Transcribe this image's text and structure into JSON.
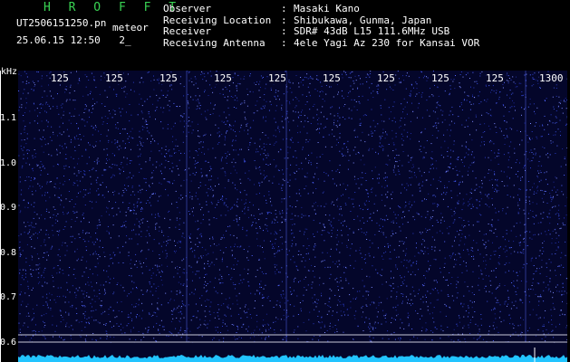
{
  "header": {
    "brand": "H R O F F T",
    "filename": "UT2506151250.pn",
    "tag": "meteor",
    "timestamp": "25.06.15 12:50",
    "counter": "2_",
    "fields": [
      {
        "key": "Observer",
        "value": "Masaki Kano"
      },
      {
        "key": "Receiving Location",
        "value": "Shibukawa, Gunma, Japan"
      },
      {
        "key": "Receiver",
        "value": "SDR# 43dB L15 111.6MHz USB"
      },
      {
        "key": "Receiving Antenna",
        "value": "4ele Yagi Az 230 for Kansai VOR"
      }
    ]
  },
  "spectrogram": {
    "unit": "kHz",
    "x_ticks": [
      "125",
      "125",
      "125",
      "125",
      "125",
      "125",
      "125",
      "125",
      "125",
      "1300"
    ],
    "y_ticks": [
      "1.1",
      "1.0",
      "0.9",
      "0.8",
      "0.7",
      "0.6"
    ],
    "colors": {
      "background": "#04062a",
      "speckle": "#3a4fd8",
      "baseline": "#22c4ff"
    }
  }
}
